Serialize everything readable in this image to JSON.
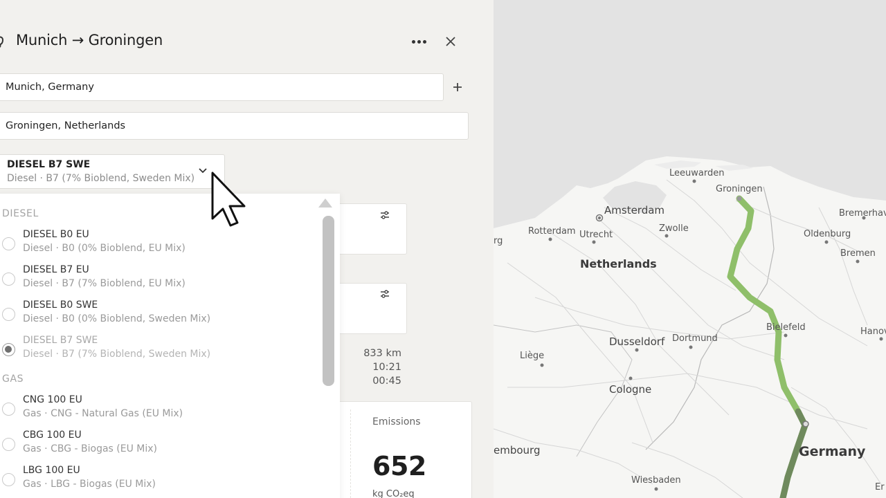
{
  "panel": {
    "title": "Munich → Groningen",
    "origin_value": "Munich, Germany",
    "destination_value": "Groningen, Netherlands",
    "selected_fuel": {
      "name": "DIESEL B7 SWE",
      "description": "Diesel · B7 (7% Bioblend, Sweden Mix)"
    },
    "stats": {
      "distance": "833 km",
      "duration": "10:21",
      "stop": "00:45"
    },
    "emissions": {
      "label": "Emissions",
      "value": "652",
      "unit": "kg CO₂eq"
    }
  },
  "dropdown": {
    "groups": [
      {
        "label": "DIESEL",
        "options": [
          {
            "name": "DIESEL B0 EU",
            "description": "Diesel · B0 (0% Bioblend, EU Mix)",
            "selected": false
          },
          {
            "name": "DIESEL B7 EU",
            "description": "Diesel · B7 (7% Bioblend, EU Mix)",
            "selected": false
          },
          {
            "name": "DIESEL B0 SWE",
            "description": "Diesel · B0 (0% Bioblend, Sweden Mix)",
            "selected": false
          },
          {
            "name": "DIESEL B7 SWE",
            "description": "Diesel · B7 (7% Bioblend, Sweden Mix)",
            "selected": true
          }
        ]
      },
      {
        "label": "GAS",
        "options": [
          {
            "name": "CNG 100 EU",
            "description": "Gas · CNG - Natural Gas (EU Mix)",
            "selected": false
          },
          {
            "name": "CBG 100 EU",
            "description": "Gas · CBG - Biogas (EU Mix)",
            "selected": false
          },
          {
            "name": "LBG 100 EU",
            "description": "Gas · LBG - Biogas (EU Mix)",
            "selected": false
          }
        ]
      }
    ]
  },
  "map": {
    "labels": {
      "leeuwarden": "Leeuwarden",
      "groningen": "Groningen",
      "amsterdam": "Amsterdam",
      "bremerhaven": "Bremerhav",
      "rotterdam": "Rotterdam",
      "utrecht": "Utrecht",
      "zwolle": "Zwolle",
      "oldenburg": "Oldenburg",
      "bremen": "Bremen",
      "netherlands": "Netherlands",
      "rg": "rg",
      "bielefeld": "Bielefeld",
      "hanover": "Hanov",
      "dusseldorf": "Dusseldorf",
      "dortmund": "Dortmund",
      "liege": "Liège",
      "cologne": "Cologne",
      "luxembourg": "embourg",
      "germany": "Germany",
      "wiesbaden": "Wiesbaden",
      "er": "Er"
    },
    "route_color": "#8fbf6a",
    "route_color_dark": "#6f8a5d"
  },
  "icons": {
    "title": "route-icon",
    "more": "more-dots-icon",
    "close": "close-icon",
    "add": "plus-icon",
    "expand": "chevron-down-icon",
    "settings": "tune-icon",
    "scroll": "scroll-up-arrow-icon",
    "pointer": "mouse-cursor-icon"
  }
}
